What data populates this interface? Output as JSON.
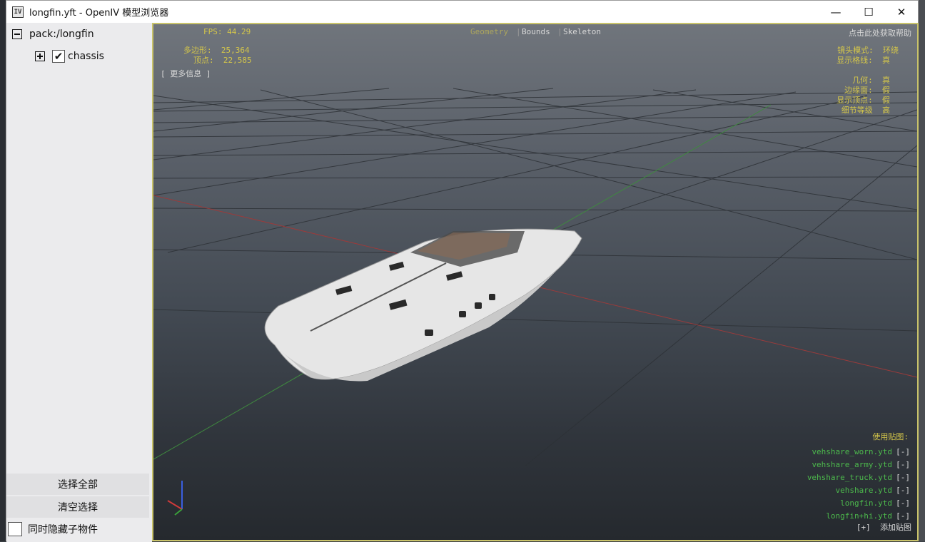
{
  "window": {
    "title": "longfin.yft - OpenIV 模型浏览器",
    "app_icon_text": "IV",
    "minimize": "—",
    "maximize": "☐",
    "close": "✕"
  },
  "sidebar": {
    "tree": [
      {
        "label": "pack:/longfin",
        "expanded": true
      },
      {
        "label": "chassis",
        "checked": true
      }
    ],
    "select_all": "选择全部",
    "clear_selection": "清空选择",
    "hide_children": "同时隐藏子物件"
  },
  "viewport": {
    "fps": "FPS: 44.29",
    "polygons": "多边形:  25,364",
    "vertices": "顶点:  22,585",
    "more_info": "[ 更多信息 ]",
    "tabs": [
      "Geometry",
      "Bounds",
      "Skeleton"
    ],
    "help": "点击此处获取帮助",
    "right_info": [
      "镜头模式:  环绕",
      "显示格线:  真",
      "",
      "几何:  真",
      "边缘面:  假",
      "显示顶点:  假",
      "细节等级  高"
    ],
    "textures_title": "使用贴图:",
    "textures": [
      "vehshare_worn.ytd",
      "vehshare_army.ytd",
      "vehshare_truck.ytd",
      "vehshare.ytd",
      "longfin.ytd",
      "longfin+hi.ytd"
    ],
    "texture_remove": "[-]",
    "add_texture": "[+]  添加贴图"
  },
  "colors": {
    "hud_yellow": "#d4c64a",
    "hud_green": "#4cb84c",
    "viewport_border": "#c9c36a"
  }
}
